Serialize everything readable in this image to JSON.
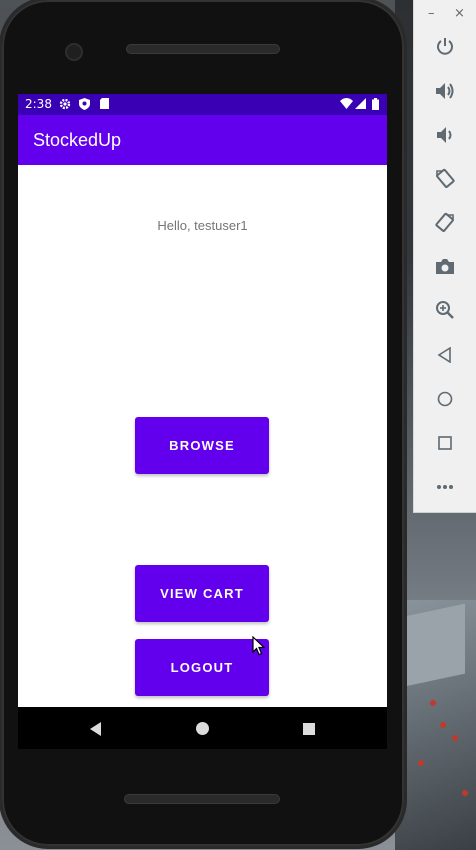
{
  "app": {
    "title": "StockedUp",
    "greeting": "Hello, testuser1"
  },
  "status_bar": {
    "time": "2:38",
    "icons": [
      "gear-icon",
      "shield-icon",
      "sd-card-icon",
      "wifi-icon",
      "signal-icon",
      "battery-icon"
    ]
  },
  "buttons": {
    "browse": "BROWSE",
    "view_cart": "VIEW CART",
    "logout": "LOGOUT"
  },
  "colors": {
    "primary": "#6200ee",
    "primary_dark": "#3a00b3",
    "background": "#ffffff",
    "greeting_text": "#757575"
  },
  "emulator": {
    "window_controls": [
      "minimize",
      "close"
    ],
    "minimize_glyph": "–",
    "close_glyph": "×",
    "controls": [
      "power",
      "volume-up",
      "volume-down",
      "rotate-left",
      "rotate-right",
      "screenshot",
      "zoom",
      "back",
      "home",
      "overview",
      "more"
    ]
  },
  "system_nav": [
    "back",
    "home",
    "recents"
  ]
}
